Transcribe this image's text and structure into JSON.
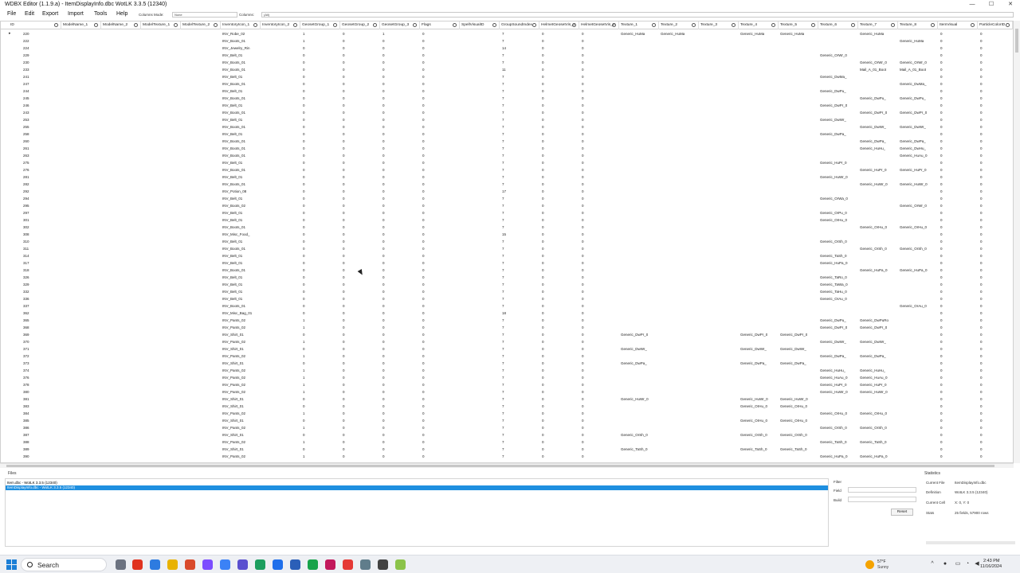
{
  "window": {
    "title": "WDBX Editor (1.1.9.a) - ItemDisplayInfo.dbc WotLK 3.3.5 (12340)",
    "minimize_glyph": "—",
    "maximize_glyph": "☐",
    "close_glyph": "✕"
  },
  "menu": {
    "items": [
      "File",
      "Edit",
      "Export",
      "Import",
      "Tools",
      "Help"
    ],
    "columns_mode_label": "Columns Mode:",
    "columns_mode_value": "None",
    "columns_label": "Columns:",
    "columns_value": "(All)"
  },
  "grid": {
    "columns": [
      "ID",
      "ModelName_1",
      "ModelName_2",
      "ModelTexture_1",
      "ModelTexture_2",
      "InventoryIcon_1",
      "InventoryIcon_2",
      "GeosetGroup_1",
      "GeosetGroup_2",
      "GeosetGroup_3",
      "Flags",
      "SpellVisualID",
      "GroupSoundIndex",
      "HelmetGeosetVis_1",
      "HelmetGeosetVis_2",
      "Texture_1",
      "Texture_2",
      "Texture_3",
      "Texture_4",
      "Texture_5",
      "Texture_6",
      "Texture_7",
      "Texture_8",
      "ItemVisual",
      "ParticleColorID"
    ],
    "rows": [
      [
        "220",
        "INV_Robe_02",
        "1",
        "0",
        "1",
        "0",
        "7",
        "0",
        "0",
        "Generic_HuMa",
        "Generic_HuMa",
        "",
        "Generic_HuMa",
        "Generic_HuMa",
        "",
        "Generic_HuMa",
        "",
        "0",
        "0"
      ],
      [
        "222",
        "INV_Boots_01",
        "1",
        "0",
        "0",
        "0",
        "7",
        "0",
        "0",
        "",
        "",
        "",
        "",
        "",
        "",
        "",
        "Generic_HuMa",
        "0",
        "0"
      ],
      [
        "224",
        "INV_Jewelry_Rin",
        "0",
        "0",
        "0",
        "0",
        "14",
        "0",
        "0",
        "",
        "",
        "",
        "",
        "",
        "",
        "",
        "",
        "0",
        "0"
      ],
      [
        "229",
        "INV_Belt_01",
        "0",
        "0",
        "0",
        "0",
        "7",
        "0",
        "0",
        "",
        "",
        "",
        "",
        "",
        "Generic_OrWr_0",
        "",
        "",
        "0",
        "0"
      ],
      [
        "230",
        "INV_Boots_01",
        "0",
        "0",
        "0",
        "0",
        "7",
        "0",
        "0",
        "",
        "",
        "",
        "",
        "",
        "",
        "Generic_OrWr_0",
        "Generic_OrWr_0",
        "0",
        "0"
      ],
      [
        "233",
        "INV_Boots_01",
        "0",
        "0",
        "0",
        "0",
        "11",
        "0",
        "0",
        "",
        "",
        "",
        "",
        "",
        "",
        "Mail_A_01_Boot",
        "Mail_A_01_Boot",
        "0",
        "0"
      ],
      [
        "241",
        "INV_Belt_01",
        "0",
        "0",
        "0",
        "0",
        "7",
        "0",
        "0",
        "",
        "",
        "",
        "",
        "",
        "Generic_DwMa_",
        "",
        "",
        "0",
        "0"
      ],
      [
        "247",
        "INV_Boots_01",
        "0",
        "0",
        "0",
        "0",
        "7",
        "0",
        "0",
        "",
        "",
        "",
        "",
        "",
        "",
        "",
        "Generic_DwMa_",
        "0",
        "0"
      ],
      [
        "244",
        "INV_Belt_01",
        "0",
        "0",
        "0",
        "0",
        "7",
        "0",
        "0",
        "",
        "",
        "",
        "",
        "",
        "Generic_DwPu_",
        "",
        "",
        "0",
        "0"
      ],
      [
        "245",
        "INV_Boots_01",
        "0",
        "0",
        "0",
        "0",
        "7",
        "0",
        "0",
        "",
        "",
        "",
        "",
        "",
        "",
        "Generic_DwPu_",
        "Generic_DwPu_",
        "0",
        "0"
      ],
      [
        "246",
        "INV_Belt_01",
        "0",
        "0",
        "0",
        "0",
        "7",
        "0",
        "0",
        "",
        "",
        "",
        "",
        "",
        "Generic_DwPr_0",
        "",
        "",
        "0",
        "0"
      ],
      [
        "243",
        "INV_Boots_01",
        "0",
        "0",
        "0",
        "0",
        "7",
        "0",
        "0",
        "",
        "",
        "",
        "",
        "",
        "",
        "Generic_DwPr_0",
        "Generic_DwPr_0",
        "0",
        "0"
      ],
      [
        "253",
        "INV_Belt_01",
        "0",
        "0",
        "0",
        "0",
        "7",
        "0",
        "0",
        "",
        "",
        "",
        "",
        "",
        "Generic_DwWr_",
        "",
        "",
        "0",
        "0"
      ],
      [
        "255",
        "INV_Boots_01",
        "0",
        "0",
        "0",
        "0",
        "7",
        "0",
        "0",
        "",
        "",
        "",
        "",
        "",
        "",
        "Generic_DwWr_",
        "Generic_DwWr_",
        "0",
        "0"
      ],
      [
        "258",
        "INV_Belt_01",
        "0",
        "0",
        "0",
        "0",
        "7",
        "0",
        "0",
        "",
        "",
        "",
        "",
        "",
        "Generic_DwPa_",
        "",
        "",
        "0",
        "0"
      ],
      [
        "260",
        "INV_Boots_01",
        "0",
        "0",
        "0",
        "0",
        "7",
        "0",
        "0",
        "",
        "",
        "",
        "",
        "",
        "",
        "Generic_DwPa_",
        "Generic_DwPa_",
        "0",
        "0"
      ],
      [
        "261",
        "INV_Boots_01",
        "0",
        "0",
        "0",
        "0",
        "7",
        "0",
        "0",
        "",
        "",
        "",
        "",
        "",
        "",
        "Generic_HuHu_",
        "Generic_DwHu_",
        "0",
        "0"
      ],
      [
        "263",
        "INV_Boots_01",
        "0",
        "0",
        "0",
        "0",
        "7",
        "0",
        "0",
        "",
        "",
        "",
        "",
        "",
        "",
        "",
        "Generic_HuAu_0",
        "0",
        "0"
      ],
      [
        "275",
        "INV_Belt_01",
        "0",
        "0",
        "0",
        "0",
        "7",
        "0",
        "0",
        "",
        "",
        "",
        "",
        "",
        "Generic_HuPr_0",
        "",
        "",
        "0",
        "0"
      ],
      [
        "276",
        "INV_Boots_01",
        "0",
        "0",
        "0",
        "0",
        "7",
        "0",
        "0",
        "",
        "",
        "",
        "",
        "",
        "",
        "Generic_HuPr_0",
        "Generic_HuPr_0",
        "0",
        "0"
      ],
      [
        "281",
        "INV_Belt_01",
        "0",
        "0",
        "0",
        "0",
        "7",
        "0",
        "0",
        "",
        "",
        "",
        "",
        "",
        "Generic_HuWr_0",
        "",
        "",
        "0",
        "0"
      ],
      [
        "282",
        "INV_Boots_01",
        "0",
        "0",
        "0",
        "0",
        "7",
        "0",
        "0",
        "",
        "",
        "",
        "",
        "",
        "",
        "Generic_HuWr_0",
        "Generic_HuWr_0",
        "0",
        "0"
      ],
      [
        "292",
        "INV_Potion_08",
        "0",
        "0",
        "0",
        "0",
        "17",
        "0",
        "0",
        "",
        "",
        "",
        "",
        "",
        "",
        "",
        "",
        "0",
        "0"
      ],
      [
        "294",
        "INV_Belt_01",
        "0",
        "0",
        "0",
        "0",
        "7",
        "0",
        "0",
        "",
        "",
        "",
        "",
        "",
        "Generic_OrWa_0",
        "",
        "",
        "0",
        "0"
      ],
      [
        "295",
        "INV_Boots_02",
        "0",
        "0",
        "0",
        "0",
        "7",
        "0",
        "0",
        "",
        "",
        "",
        "",
        "",
        "",
        "",
        "Generic_OrWr_0",
        "0",
        "0"
      ],
      [
        "297",
        "INV_Belt_01",
        "0",
        "0",
        "0",
        "0",
        "7",
        "0",
        "0",
        "",
        "",
        "",
        "",
        "",
        "Generic_OrPu_0",
        "",
        "",
        "0",
        "0"
      ],
      [
        "301",
        "INV_Belt_01",
        "0",
        "0",
        "0",
        "0",
        "7",
        "0",
        "0",
        "",
        "",
        "",
        "",
        "",
        "Generic_OrHu_0",
        "",
        "",
        "0",
        "0"
      ],
      [
        "302",
        "INV_Boots_01",
        "0",
        "0",
        "0",
        "0",
        "7",
        "0",
        "0",
        "",
        "",
        "",
        "",
        "",
        "",
        "Generic_OrHu_0",
        "Generic_OrHu_0",
        "0",
        "0"
      ],
      [
        "308",
        "INV_Misc_Food_",
        "0",
        "0",
        "0",
        "0",
        "15",
        "0",
        "0",
        "",
        "",
        "",
        "",
        "",
        "",
        "",
        "",
        "0",
        "0"
      ],
      [
        "310",
        "INV_Belt_01",
        "0",
        "0",
        "0",
        "0",
        "7",
        "0",
        "0",
        "",
        "",
        "",
        "",
        "",
        "Generic_OrSh_0",
        "",
        "",
        "0",
        "0"
      ],
      [
        "311",
        "INV_Boots_01",
        "0",
        "0",
        "0",
        "0",
        "7",
        "0",
        "0",
        "",
        "",
        "",
        "",
        "",
        "",
        "Generic_OrSh_0",
        "Generic_OrSh_0",
        "0",
        "0"
      ],
      [
        "314",
        "INV_Belt_01",
        "0",
        "0",
        "0",
        "0",
        "7",
        "0",
        "0",
        "",
        "",
        "",
        "",
        "",
        "Generic_TaSh_0",
        "",
        "",
        "0",
        "0"
      ],
      [
        "317",
        "INV_Belt_01",
        "0",
        "0",
        "0",
        "0",
        "7",
        "0",
        "0",
        "",
        "",
        "",
        "",
        "",
        "Generic_HuPa_0",
        "",
        "",
        "0",
        "0"
      ],
      [
        "318",
        "INV_Boots_01",
        "0",
        "0",
        "0",
        "0",
        "7",
        "0",
        "0",
        "",
        "",
        "",
        "",
        "",
        "",
        "Generic_HuPa_0",
        "Generic_HuPa_0",
        "0",
        "0"
      ],
      [
        "326",
        "INV_Belt_01",
        "0",
        "0",
        "0",
        "0",
        "7",
        "0",
        "0",
        "",
        "",
        "",
        "",
        "",
        "Generic_TaRo_0",
        "",
        "",
        "0",
        "0"
      ],
      [
        "329",
        "INV_Belt_01",
        "0",
        "0",
        "0",
        "0",
        "7",
        "0",
        "0",
        "",
        "",
        "",
        "",
        "",
        "Generic_TaWa_0",
        "",
        "",
        "0",
        "0"
      ],
      [
        "332",
        "INV_Belt_01",
        "0",
        "0",
        "0",
        "0",
        "7",
        "0",
        "0",
        "",
        "",
        "",
        "",
        "",
        "Generic_TaHu_0",
        "",
        "",
        "0",
        "0"
      ],
      [
        "336",
        "INV_Belt_01",
        "0",
        "0",
        "0",
        "0",
        "7",
        "0",
        "0",
        "",
        "",
        "",
        "",
        "",
        "Generic_OrAu_0",
        "",
        "",
        "0",
        "0"
      ],
      [
        "337",
        "INV_Boots_01",
        "0",
        "0",
        "0",
        "0",
        "7",
        "0",
        "0",
        "",
        "",
        "",
        "",
        "",
        "",
        "",
        "Generic_OrAu_0",
        "0",
        "0"
      ],
      [
        "362",
        "INV_Misc_Bag_01",
        "0",
        "0",
        "0",
        "0",
        "18",
        "0",
        "0",
        "",
        "",
        "",
        "",
        "",
        "",
        "",
        "",
        "0",
        "0"
      ],
      [
        "365",
        "INV_Pants_02",
        "1",
        "0",
        "0",
        "0",
        "7",
        "0",
        "0",
        "",
        "",
        "",
        "",
        "",
        "Generic_DwPu_",
        "Generic_DwPuRo",
        "",
        "0",
        "0"
      ],
      [
        "368",
        "INV_Pants_02",
        "1",
        "0",
        "0",
        "0",
        "7",
        "0",
        "0",
        "",
        "",
        "",
        "",
        "",
        "Generic_DwPr_0",
        "Generic_DwPr_0",
        "",
        "0",
        "0"
      ],
      [
        "369",
        "INV_Shirt_01",
        "0",
        "0",
        "0",
        "0",
        "7",
        "0",
        "0",
        "Generic_DwPr_0",
        "",
        "",
        "Generic_DwPr_0",
        "Generic_DwPr_0",
        "",
        "",
        "",
        "0",
        "0"
      ],
      [
        "370",
        "INV_Pants_02",
        "1",
        "0",
        "0",
        "0",
        "7",
        "0",
        "0",
        "",
        "",
        "",
        "",
        "",
        "Generic_DwWr_",
        "Generic_DwWr_",
        "",
        "0",
        "0"
      ],
      [
        "371",
        "INV_Shirt_01",
        "0",
        "0",
        "0",
        "0",
        "7",
        "0",
        "0",
        "Generic_DwWr_",
        "",
        "",
        "Generic_DwWr_",
        "Generic_DwWr_",
        "",
        "",
        "",
        "0",
        "0"
      ],
      [
        "372",
        "INV_Pants_02",
        "1",
        "0",
        "0",
        "0",
        "7",
        "0",
        "0",
        "",
        "",
        "",
        "",
        "",
        "Generic_DwPa_",
        "Generic_DwPa_",
        "",
        "0",
        "0"
      ],
      [
        "373",
        "INV_Shirt_01",
        "0",
        "0",
        "0",
        "0",
        "7",
        "0",
        "0",
        "Generic_DwPa_",
        "",
        "",
        "Generic_DwPa_",
        "Generic_DwPa_",
        "",
        "",
        "",
        "0",
        "0"
      ],
      [
        "374",
        "INV_Pants_02",
        "1",
        "0",
        "0",
        "0",
        "7",
        "0",
        "0",
        "",
        "",
        "",
        "",
        "",
        "Generic_HuHu_",
        "Generic_HuHu_",
        "",
        "0",
        "0"
      ],
      [
        "376",
        "INV_Pants_02",
        "1",
        "0",
        "0",
        "0",
        "7",
        "0",
        "0",
        "",
        "",
        "",
        "",
        "",
        "Generic_HuAu_0",
        "Generic_HuAu_0",
        "",
        "0",
        "0"
      ],
      [
        "378",
        "INV_Pants_02",
        "1",
        "0",
        "0",
        "0",
        "7",
        "0",
        "0",
        "",
        "",
        "",
        "",
        "",
        "Generic_HuPr_0",
        "Generic_HuPr_0",
        "",
        "0",
        "0"
      ],
      [
        "380",
        "INV_Pants_02",
        "1",
        "0",
        "0",
        "0",
        "7",
        "0",
        "0",
        "",
        "",
        "",
        "",
        "",
        "Generic_HuWr_0",
        "Generic_HuWr_0",
        "",
        "0",
        "0"
      ],
      [
        "381",
        "INV_Shirt_01",
        "0",
        "0",
        "0",
        "0",
        "7",
        "0",
        "0",
        "Generic_HuWr_0",
        "",
        "",
        "Generic_HuWr_0",
        "Generic_HuWr_0",
        "",
        "",
        "",
        "0",
        "0"
      ],
      [
        "383",
        "INV_Shirt_01",
        "0",
        "0",
        "0",
        "0",
        "7",
        "0",
        "0",
        "",
        "",
        "",
        "Generic_OrHu_0",
        "Generic_OrHu_0",
        "",
        "",
        "",
        "0",
        "0"
      ],
      [
        "384",
        "INV_Pants_02",
        "1",
        "0",
        "0",
        "0",
        "7",
        "0",
        "0",
        "",
        "",
        "",
        "",
        "",
        "Generic_OrHu_0",
        "Generic_OrHu_0",
        "",
        "0",
        "0"
      ],
      [
        "385",
        "INV_Shirt_01",
        "0",
        "0",
        "0",
        "0",
        "7",
        "0",
        "0",
        "",
        "",
        "",
        "Generic_OrHu_0",
        "Generic_OrHu_0",
        "",
        "",
        "",
        "0",
        "0"
      ],
      [
        "386",
        "INV_Pants_02",
        "1",
        "0",
        "0",
        "0",
        "7",
        "0",
        "0",
        "",
        "",
        "",
        "",
        "",
        "Generic_OrSh_0",
        "Generic_OrSh_0",
        "",
        "0",
        "0"
      ],
      [
        "387",
        "INV_Shirt_01",
        "0",
        "0",
        "0",
        "0",
        "7",
        "0",
        "0",
        "Generic_OrSh_0",
        "",
        "",
        "Generic_OrSh_0",
        "Generic_OrSh_0",
        "",
        "",
        "",
        "0",
        "0"
      ],
      [
        "388",
        "INV_Pants_02",
        "1",
        "0",
        "0",
        "0",
        "7",
        "0",
        "0",
        "",
        "",
        "",
        "",
        "",
        "Generic_TaSh_0",
        "Generic_TaSh_0",
        "",
        "0",
        "0"
      ],
      [
        "389",
        "INV_Shirt_01",
        "0",
        "0",
        "0",
        "0",
        "7",
        "0",
        "0",
        "Generic_TaSh_0",
        "",
        "",
        "Generic_TaSh_0",
        "Generic_TaSh_0",
        "",
        "",
        "",
        "0",
        "0"
      ],
      [
        "390",
        "INV_Pants_02",
        "1",
        "0",
        "0",
        "0",
        "7",
        "0",
        "0",
        "",
        "",
        "",
        "",
        "",
        "Generic_HuPa_0",
        "Generic_HuPa_0",
        "",
        "0",
        "0"
      ]
    ]
  },
  "files": {
    "label": "Files",
    "items": [
      "Item.dbc - WotLK 3.3.5 (12340)",
      "ItemDisplayInfo.dbc - WotLK 3.3.5 (12340)"
    ],
    "selected_index": 1
  },
  "filter": {
    "filter_label": "Filter",
    "filter_value": "",
    "field_label": "Field",
    "build_label": "Build",
    "build_value": "",
    "reset_label": "Reset"
  },
  "statistics": {
    "label": "Statistics",
    "current_file_label": "Current File",
    "current_file_value": "ItemDisplayInfo.dbc",
    "definition_label": "Definition",
    "definition_value": "WotLK 3.3.5 (12340)",
    "current_cell_label": "Current Cell",
    "current_cell_value": "X: 0, Y: 0",
    "stats_label": "Stats",
    "stats_value": "25 fields, 57900 rows"
  },
  "taskbar": {
    "search_label": "Search",
    "weather_temp": "57°F",
    "weather_desc": "Sunny",
    "time": "2:43 PM",
    "date": "11/16/2024",
    "icon_colors": [
      "#6b7280",
      "#e0331f",
      "#2d7be0",
      "#e8b200",
      "#d94a2b",
      "#7c4dff",
      "#3b82f6",
      "#5a4fcf",
      "#1d9e5f",
      "#1f6feb",
      "#2b5fb8",
      "#17a34a",
      "#c2185b",
      "#e53935",
      "#607d8b",
      "#424242",
      "#8bc34a"
    ]
  }
}
